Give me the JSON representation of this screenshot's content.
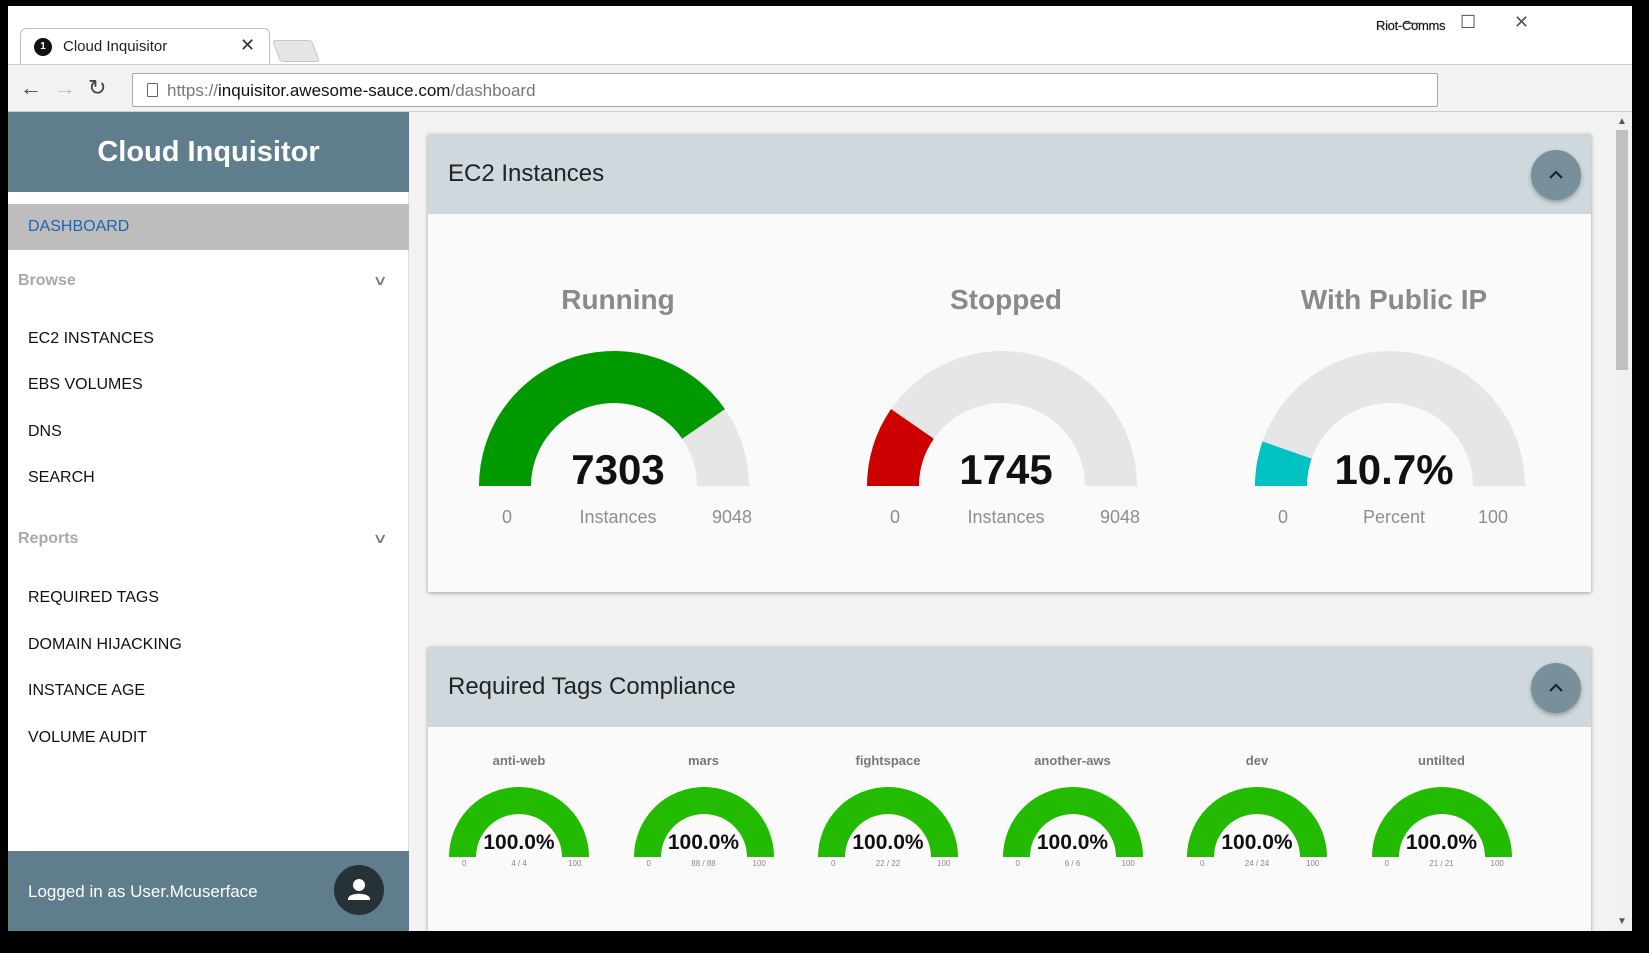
{
  "browser": {
    "tab_title": "Cloud Inquisitor",
    "tab_badge": "1",
    "tab_close": "✕",
    "profile": "Riot-Comms",
    "url_scheme": "https://",
    "url_host": "inquisitor.awesome-sauce.com",
    "url_path": "/dashboard",
    "min_btn": "—",
    "max_btn": "☐",
    "close_btn": "✕",
    "back": "←",
    "forward": "→",
    "reload": "↻"
  },
  "sidebar": {
    "app_title": "Cloud Inquisitor",
    "active_item": "DASHBOARD",
    "groups": [
      {
        "label": "Browse",
        "items": [
          "EC2 INSTANCES",
          "EBS VOLUMES",
          "DNS",
          "SEARCH"
        ]
      },
      {
        "label": "Reports",
        "items": [
          "REQUIRED TAGS",
          "DOMAIN HIJACKING",
          "INSTANCE AGE",
          "VOLUME AUDIT"
        ]
      }
    ],
    "footer_text": "Logged in as User.Mcuserface"
  },
  "ec2_card": {
    "title": "EC2 Instances",
    "gauges": [
      {
        "title": "Running",
        "value": "7303",
        "unit": "Instances",
        "min": "0",
        "max": "9048",
        "fraction": 0.807,
        "color": "#009900"
      },
      {
        "title": "Stopped",
        "value": "1745",
        "unit": "Instances",
        "min": "0",
        "max": "9048",
        "fraction": 0.193,
        "color": "#cc0000"
      },
      {
        "title": "With Public IP",
        "value": "10.7%",
        "unit": "Percent",
        "min": "0",
        "max": "100",
        "fraction": 0.107,
        "color": "#00c2c2"
      }
    ]
  },
  "tags_card": {
    "title": "Required Tags Compliance",
    "gauges": [
      {
        "title": "anti-web",
        "value": "100.0%",
        "count": "4 / 4",
        "min": "0",
        "max": "100",
        "fraction": 1.0
      },
      {
        "title": "mars",
        "value": "100.0%",
        "count": "88 / 88",
        "min": "0",
        "max": "100",
        "fraction": 1.0
      },
      {
        "title": "fightspace",
        "value": "100.0%",
        "count": "22 / 22",
        "min": "0",
        "max": "100",
        "fraction": 1.0
      },
      {
        "title": "another-aws",
        "value": "100.0%",
        "count": "6 / 6",
        "min": "0",
        "max": "100",
        "fraction": 1.0
      },
      {
        "title": "dev",
        "value": "100.0%",
        "count": "24 / 24",
        "min": "0",
        "max": "100",
        "fraction": 1.0
      },
      {
        "title": "untilted",
        "value": "100.0%",
        "count": "21 / 21",
        "min": "0",
        "max": "100",
        "fraction": 1.0
      }
    ],
    "color": "#22bb00"
  },
  "colors": {
    "sidebar": "#5f7d8c",
    "card_header": "#cfd8dc",
    "track": "#e6e6e6",
    "active_link": "#1e64b4"
  }
}
